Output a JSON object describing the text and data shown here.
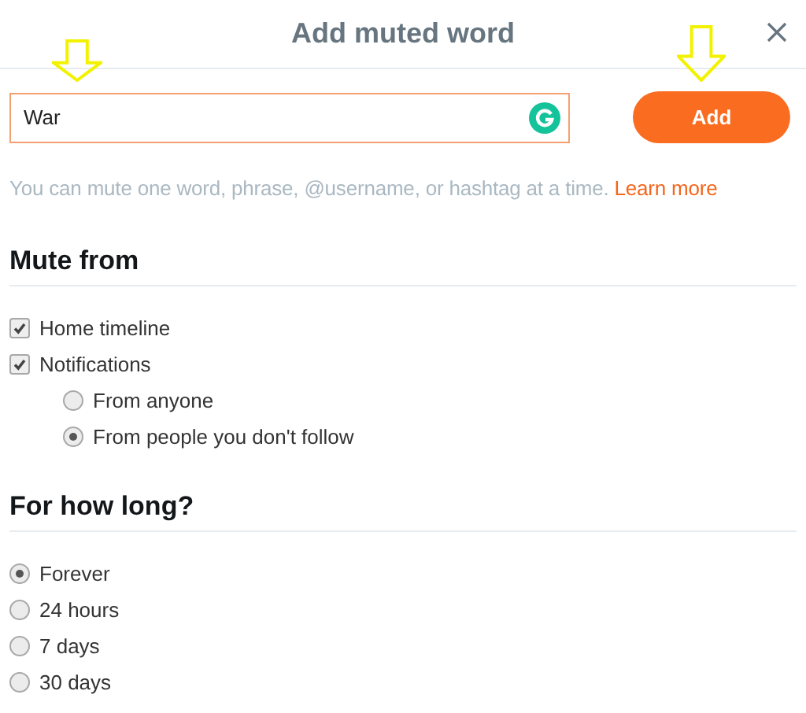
{
  "dialog": {
    "title": "Add muted word"
  },
  "entry": {
    "value": "War",
    "button": "Add"
  },
  "help": {
    "text": "You can mute one word, phrase, @username, or hashtag at a time.",
    "link": "Learn more"
  },
  "sections": [
    {
      "heading": "Mute from",
      "options": [
        {
          "kind": "checkbox",
          "label": "Home timeline",
          "checked": true
        },
        {
          "kind": "checkbox",
          "label": "Notifications",
          "checked": true,
          "children": [
            {
              "kind": "radio",
              "label": "From anyone",
              "selected": false
            },
            {
              "kind": "radio",
              "label": "From people you don't follow",
              "selected": true
            }
          ]
        }
      ]
    },
    {
      "heading": "For how long?",
      "options": [
        {
          "kind": "radio",
          "label": "Forever",
          "selected": true
        },
        {
          "kind": "radio",
          "label": "24 hours",
          "selected": false
        },
        {
          "kind": "radio",
          "label": "7 days",
          "selected": false
        },
        {
          "kind": "radio",
          "label": "30 days",
          "selected": false
        }
      ]
    }
  ],
  "annotations": [
    {
      "kind": "arrow"
    },
    {
      "kind": "arrow"
    }
  ]
}
